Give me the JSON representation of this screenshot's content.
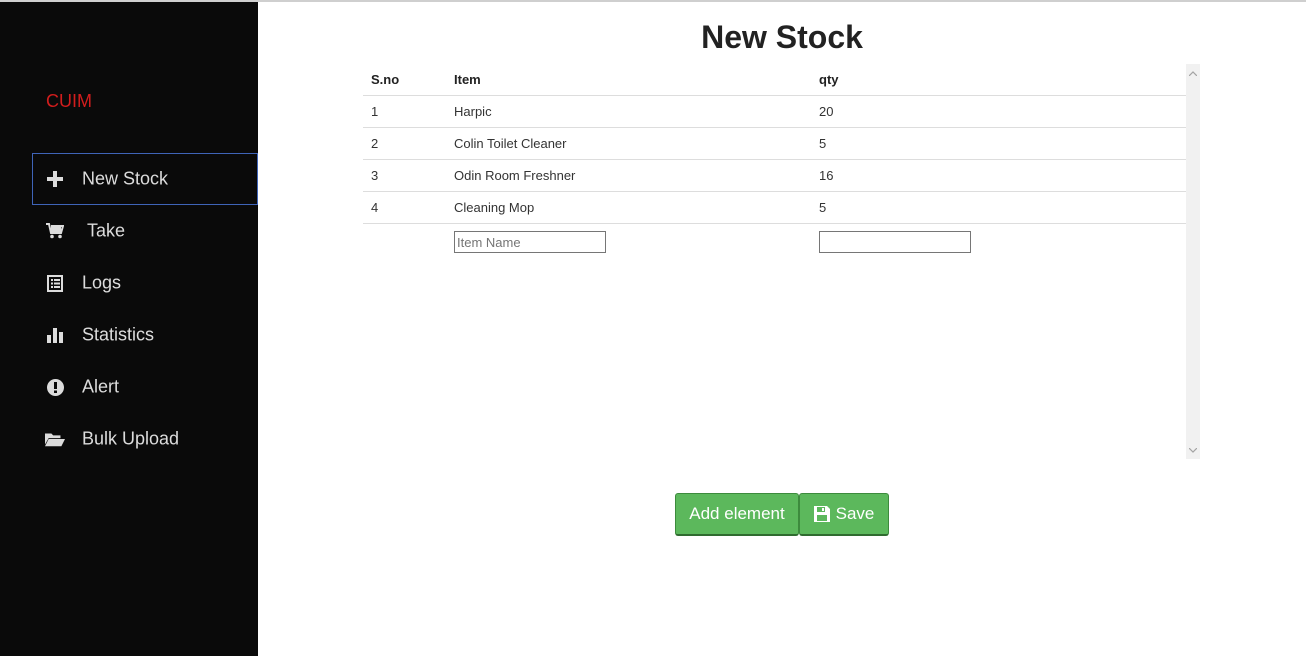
{
  "app": {
    "brand": "CUIM"
  },
  "sidebar": {
    "items": [
      {
        "label": "New Stock",
        "icon": "plus-icon",
        "active": true
      },
      {
        "label": "Take",
        "icon": "cart-icon",
        "active": false
      },
      {
        "label": "Logs",
        "icon": "list-icon",
        "active": false
      },
      {
        "label": "Statistics",
        "icon": "bar-chart-icon",
        "active": false
      },
      {
        "label": "Alert",
        "icon": "exclamation-circle-icon",
        "active": false
      },
      {
        "label": "Bulk Upload",
        "icon": "folder-open-icon",
        "active": false
      }
    ]
  },
  "main": {
    "title": "New Stock",
    "table": {
      "headers": [
        "S.no",
        "Item",
        "qty"
      ],
      "rows": [
        [
          "1",
          "Harpic",
          "20"
        ],
        [
          "2",
          "Colin Toilet Cleaner",
          "5"
        ],
        [
          "3",
          "Odin Room Freshner",
          "16"
        ],
        [
          "4",
          "Cleaning Mop",
          "5"
        ]
      ],
      "new_row": {
        "item_placeholder": "Item Name",
        "item_value": "",
        "qty_placeholder": "",
        "qty_value": ""
      }
    },
    "buttons": {
      "add_label": "Add element",
      "save_label": "Save"
    }
  },
  "colors": {
    "sidebar_bg": "#0a0a0a",
    "brand": "#d21d1d",
    "active_border": "#3f64b8",
    "button_green": "#5cb85c"
  }
}
